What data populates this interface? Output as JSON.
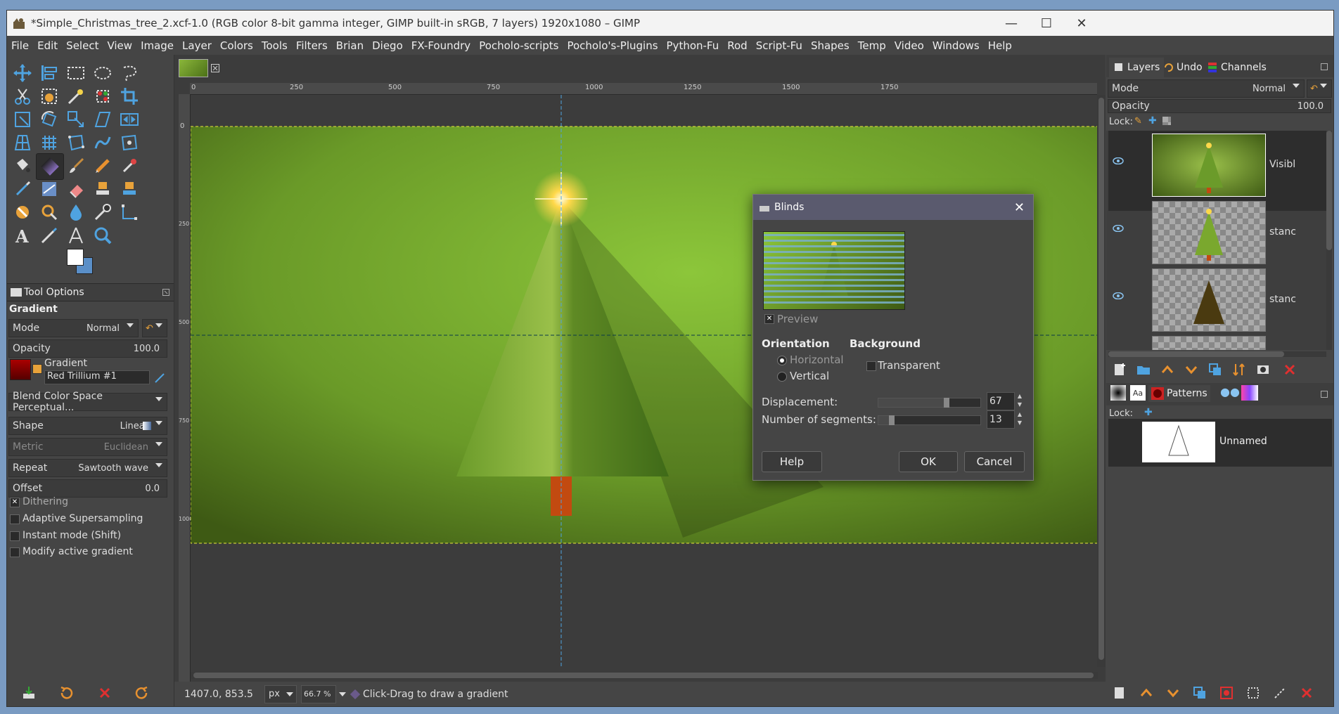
{
  "window": {
    "title": "*Simple_Christmas_tree_2.xcf-1.0 (RGB color 8-bit gamma integer, GIMP built-in sRGB, 7 layers) 1920x1080 – GIMP"
  },
  "menu": [
    "File",
    "Edit",
    "Select",
    "View",
    "Image",
    "Layer",
    "Colors",
    "Tools",
    "Filters",
    "Brian",
    "Diego",
    "FX-Foundry",
    "Pocholo-scripts",
    "Pocholo's-Plugins",
    "Python-Fu",
    "Rod",
    "Script-Fu",
    "Shapes",
    "Temp",
    "Video",
    "Windows",
    "Help"
  ],
  "ruler": {
    "h": [
      "0",
      "250",
      "500",
      "750",
      "1000",
      "1250",
      "1500",
      "1750"
    ],
    "v": [
      "0",
      "250",
      "500",
      "750",
      "1000"
    ]
  },
  "tool_options": {
    "tab": "Tool Options",
    "tool_name": "Gradient",
    "mode_label": "Mode",
    "mode_value": "Normal",
    "opacity_label": "Opacity",
    "opacity_value": "100.0",
    "gradient_label": "Gradient",
    "gradient_value": "Red Trillium #1",
    "blend_space": "Blend Color Space Perceptual...",
    "shape_label": "Shape",
    "shape_value": "Linear",
    "metric_label": "Metric",
    "metric_value": "Euclidean",
    "repeat_label": "Repeat",
    "repeat_value": "Sawtooth wave",
    "offset_label": "Offset",
    "offset_value": "0.0",
    "dithering": "Dithering",
    "adaptive": "Adaptive Supersampling",
    "instant": "Instant mode  (Shift)",
    "modify": "Modify active gradient"
  },
  "status": {
    "coords": "1407.0, 853.5",
    "unit": "px",
    "zoom": "66.7 %",
    "message": "Click-Drag to draw a gradient"
  },
  "layers_dock": {
    "tabs": [
      "Layers",
      "Undo",
      "Channels"
    ],
    "mode_label": "Mode",
    "mode_value": "Normal",
    "opacity_label": "Opacity",
    "opacity_value": "100.0",
    "lock_label": "Lock:",
    "layers": [
      {
        "name": "Visibl"
      },
      {
        "name": "stanc"
      },
      {
        "name": "stanc"
      }
    ]
  },
  "patterns_dock": {
    "tab": "Patterns",
    "lock_label": "Lock:",
    "item": "Unnamed"
  },
  "dialog": {
    "title": "Blinds",
    "preview_label": "Preview",
    "orientation_label": "Orientation",
    "horizontal": "Horizontal",
    "vertical": "Vertical",
    "background_label": "Background",
    "transparent": "Transparent",
    "displacement_label": "Displacement:",
    "displacement_value": "67",
    "displacement_fraction": 0.67,
    "segments_label": "Number of segments:",
    "segments_value": "13",
    "segments_fraction": 0.13,
    "help": "Help",
    "ok": "OK",
    "cancel": "Cancel"
  },
  "colors": {
    "accent": "#d04020",
    "canvas_green": "#7fb22e",
    "dialog_header": "#5a5a6e"
  }
}
